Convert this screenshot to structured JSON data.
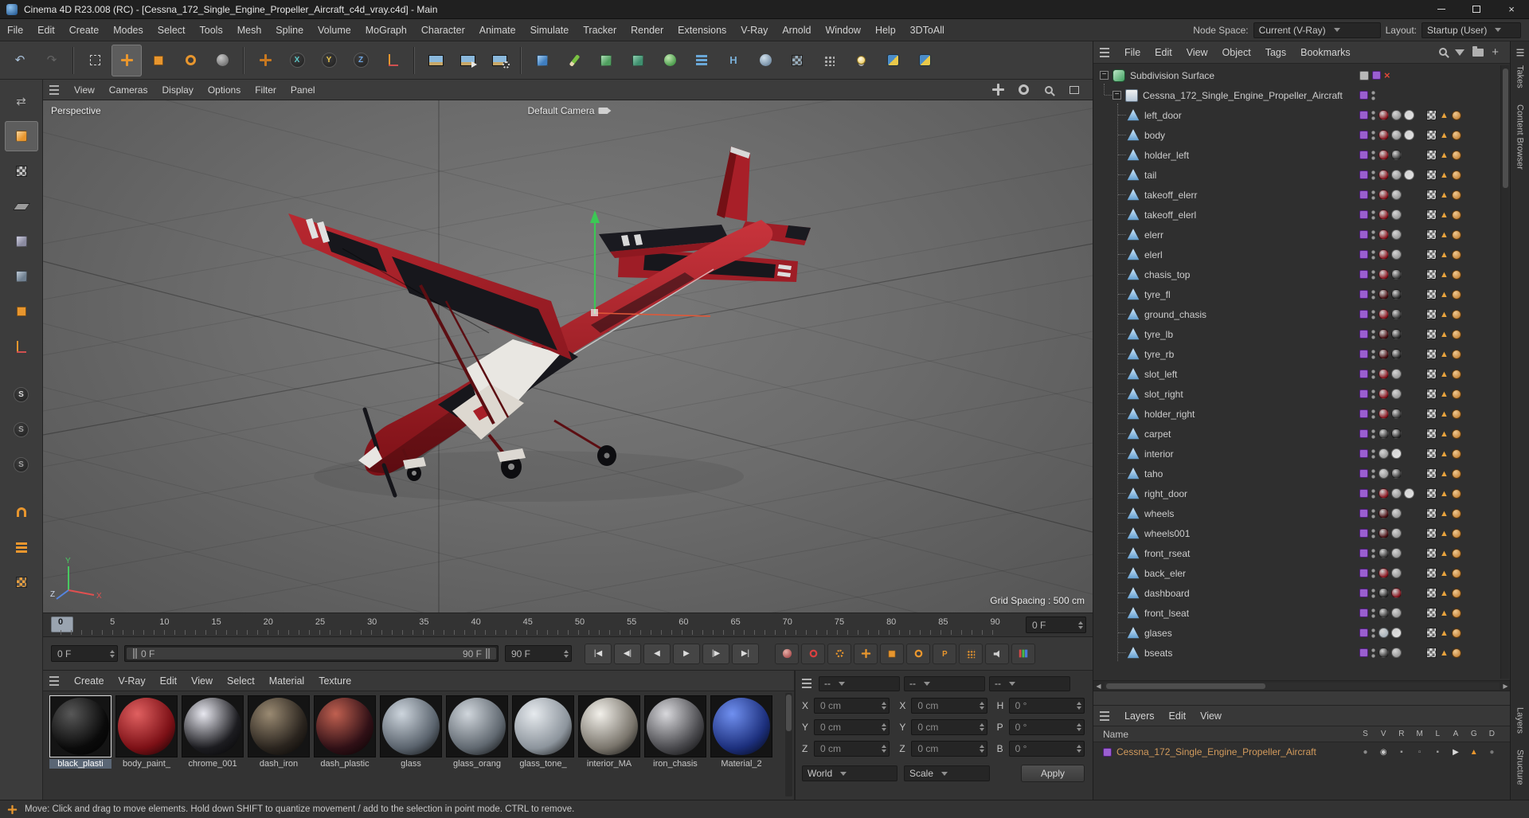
{
  "window": {
    "title": "Cinema 4D R23.008 (RC) - [Cessna_172_Single_Engine_Propeller_Aircraft_c4d_vray.c4d] - Main"
  },
  "menubar": {
    "items": [
      "File",
      "Edit",
      "Create",
      "Modes",
      "Select",
      "Tools",
      "Mesh",
      "Spline",
      "Volume",
      "MoGraph",
      "Character",
      "Animate",
      "Simulate",
      "Tracker",
      "Render",
      "Extensions",
      "V-Ray",
      "Arnold",
      "Window",
      "Help",
      "3DToAll"
    ],
    "node_space_label": "Node Space:",
    "node_space_value": "Current (V-Ray)",
    "layout_label": "Layout:",
    "layout_value": "Startup (User)"
  },
  "toolbar": {
    "buttons": [
      {
        "n": "undo-button",
        "t": "glyph",
        "g": "↶",
        "c": "#a8c0d8"
      },
      {
        "n": "redo-button",
        "t": "glyph",
        "g": "↷",
        "c": "#646464"
      },
      {
        "sep": true
      },
      {
        "n": "live-selection-tool",
        "t": "dashed"
      },
      {
        "n": "move-tool",
        "t": "cross",
        "c": "#e8962e",
        "active": true
      },
      {
        "n": "scale-tool",
        "t": "box",
        "c": "#e8962e"
      },
      {
        "n": "rotate-tool",
        "t": "ring",
        "c": "#e8962e"
      },
      {
        "n": "last-used-tool",
        "t": "sphere",
        "c": "#7a7a7a",
        "hi": "#c8c8c8"
      },
      {
        "sep": true
      },
      {
        "n": "omni-move-tool",
        "t": "cross",
        "c": "#c87820"
      },
      {
        "n": "lock-x-axis-button",
        "t": "cletter",
        "g": "X",
        "c": "#5cc8c8"
      },
      {
        "n": "lock-y-axis-button",
        "t": "cletter",
        "g": "Y",
        "c": "#e8c44c"
      },
      {
        "n": "lock-z-axis-button",
        "t": "cletter",
        "g": "Z",
        "c": "#6ea8e8"
      },
      {
        "n": "coordinate-system-button",
        "t": "axes",
        "c": "#e8962e"
      },
      {
        "sep": true
      },
      {
        "n": "render-view-button",
        "t": "pic"
      },
      {
        "n": "render-picture-viewer-button",
        "t": "pic",
        "badge": "play"
      },
      {
        "n": "render-settings-button",
        "t": "pic",
        "badge": "gear"
      },
      {
        "sep": true
      },
      {
        "n": "add-cube-button",
        "t": "cube",
        "c": "#3f7ec0",
        "hi": "#a8d0f0"
      },
      {
        "n": "pen-tool-button",
        "t": "pen",
        "c": "#7ac142"
      },
      {
        "n": "subdivision-surface-button",
        "t": "cube",
        "c": "#4f9f5f",
        "hi": "#b0e0b8"
      },
      {
        "n": "generator-button",
        "t": "cube",
        "c": "#3f8f6f",
        "hi": "#90d0b0"
      },
      {
        "n": "array-button",
        "t": "sphere",
        "c": "#4f9f4f",
        "hi": "#c0e8b0"
      },
      {
        "n": "instance-button",
        "t": "stack",
        "c": "#6aa8d8"
      },
      {
        "n": "connect-button",
        "t": "letter",
        "g": "H",
        "c": "#7ab0d8"
      },
      {
        "n": "volume-builder-button",
        "t": "sphere",
        "c": "#7a92a8",
        "hi": "#d0e0ec"
      },
      {
        "n": "field-button",
        "t": "checker",
        "c": "#9ab0c0"
      },
      {
        "n": "simulate-button",
        "t": "dots",
        "c": "#b0b0b0"
      },
      {
        "n": "light-button",
        "t": "bulb"
      },
      {
        "n": "python-button",
        "t": "py"
      },
      {
        "n": "xpresso-button",
        "t": "py"
      }
    ]
  },
  "left_toolbar": {
    "buttons": [
      {
        "n": "convert-selection-tool",
        "t": "glyph",
        "g": "⇄",
        "c": "#b0b0b0"
      },
      {
        "n": "model-mode-button",
        "t": "cube",
        "c": "#e8962e",
        "hi": "#f8d8a0",
        "active": true
      },
      {
        "n": "texture-mode-button",
        "t": "checker",
        "c": "#c8c8c8"
      },
      {
        "n": "workplane-mode-button",
        "t": "plane",
        "c": "#9a9a9a"
      },
      {
        "n": "points-mode-button",
        "t": "cube",
        "c": "#8a8aa0",
        "hi": "#d0d0e0"
      },
      {
        "n": "edges-mode-button",
        "t": "cube",
        "c": "#708090",
        "hi": "#c0ccd8"
      },
      {
        "n": "polygons-mode-button",
        "t": "box",
        "c": "#e8962e"
      },
      {
        "n": "axis-mode-button",
        "t": "axes",
        "c": "#e8962e"
      },
      {
        "gap": true
      },
      {
        "n": "enable-snap-button",
        "t": "cletter",
        "g": "S",
        "c": "#d8d8d8"
      },
      {
        "n": "snap-setting-1-button",
        "t": "cletter",
        "g": "S",
        "c": "#a0a0a0"
      },
      {
        "n": "snap-setting-2-button",
        "t": "cletter",
        "g": "S",
        "c": "#a0a0a0"
      },
      {
        "gap": true
      },
      {
        "n": "magnet-snap-button",
        "t": "magnet",
        "c": "#e8962e"
      },
      {
        "n": "quantize-button",
        "t": "stack",
        "c": "#e8962e"
      },
      {
        "n": "workplane-snap-button",
        "t": "checker",
        "c": "#e8a040"
      }
    ]
  },
  "viewport": {
    "menu": [
      "View",
      "Cameras",
      "Display",
      "Options",
      "Filter",
      "Panel"
    ],
    "view_icons": [
      {
        "n": "pan-view-button",
        "t": "cross",
        "c": "#c0c0c0"
      },
      {
        "n": "orbit-view-button",
        "t": "ring",
        "c": "#c0c0c0"
      },
      {
        "n": "zoom-view-button",
        "t": "search"
      },
      {
        "n": "maximize-view-button",
        "t": "frame"
      }
    ],
    "label": "Perspective",
    "camera_label": "Default Camera",
    "grid_spacing": "Grid Spacing : 500 cm",
    "axis_x": "X",
    "axis_y": "Y",
    "axis_z": "Z"
  },
  "timeline": {
    "ticks": [
      "0",
      "5",
      "10",
      "15",
      "20",
      "25",
      "30",
      "35",
      "40",
      "45",
      "50",
      "55",
      "60",
      "65",
      "70",
      "75",
      "80",
      "85",
      "90"
    ],
    "frame_field": "0 F",
    "start_field": "0 F",
    "end_field": "90 F",
    "range_start": "0 F",
    "range_end": "90 F",
    "transport": [
      {
        "name": "jump-start-button",
        "glyph": "|◀"
      },
      {
        "name": "previous-frame-button",
        "glyph": "◀|"
      },
      {
        "name": "previous-key-button",
        "glyph": "◀"
      },
      {
        "name": "play-button",
        "glyph": "▶"
      },
      {
        "name": "next-frame-button",
        "glyph": "|▶"
      },
      {
        "name": "jump-end-button",
        "glyph": "▶|"
      }
    ],
    "record": [
      {
        "n": "record-scrub-button",
        "t": "sphere",
        "c": "#b05858",
        "hi": "#e8b0a8"
      },
      {
        "n": "keyframe-record-button",
        "t": "ring",
        "c": "#d84040"
      },
      {
        "n": "autokey-button",
        "t": "gear",
        "c": "#e8962e"
      },
      {
        "n": "record-position-toggle",
        "t": "cross",
        "c": "#e8962e"
      },
      {
        "n": "record-scale-toggle",
        "t": "box",
        "c": "#e8962e"
      },
      {
        "n": "record-rotation-toggle",
        "t": "ring",
        "c": "#e8962e"
      },
      {
        "n": "record-parameter-toggle",
        "t": "letter",
        "g": "P",
        "c": "#e8962e"
      },
      {
        "n": "record-pla-toggle",
        "t": "dots",
        "c": "#e8962e"
      },
      {
        "n": "sound-toggle",
        "t": "speaker"
      },
      {
        "n": "timeline-chart-button",
        "t": "bars"
      }
    ]
  },
  "materials": {
    "menu": [
      "Create",
      "V-Ray",
      "Edit",
      "View",
      "Select",
      "Material",
      "Texture"
    ],
    "items": [
      {
        "name": "black_plasti",
        "base": "#0a0a0a",
        "highlight": "#585858",
        "selected": true
      },
      {
        "name": "body_paint_",
        "base": "#7c1016",
        "highlight": "#e06060"
      },
      {
        "name": "chrome_001",
        "base": "#1c1c20",
        "highlight": "#e8e8f0"
      },
      {
        "name": "dash_iron",
        "base": "#2a241e",
        "highlight": "#9a8a72"
      },
      {
        "name": "dash_plastic",
        "base": "#301016",
        "highlight": "#c06050"
      },
      {
        "name": "glass",
        "base": "#5a636d",
        "highlight": "#cdd5dd"
      },
      {
        "name": "glass_orang",
        "base": "#606870",
        "highlight": "#d0d6dc"
      },
      {
        "name": "glass_tone_",
        "base": "#8c949c",
        "highlight": "#e6eaee"
      },
      {
        "name": "interior_MA",
        "base": "#7a756c",
        "highlight": "#f2f0ea"
      },
      {
        "name": "iron_chasis",
        "base": "#4a4a4e",
        "highlight": "#d8d8dc"
      },
      {
        "name": "Material_2",
        "base": "#1c2f7c",
        "highlight": "#7090f0"
      }
    ]
  },
  "coordinates": {
    "filters": [
      "--",
      "--",
      "--"
    ],
    "rows": [
      {
        "a": "X",
        "av": "0 cm",
        "b": "X",
        "bv": "0 cm",
        "c": "H",
        "cv": "0 °"
      },
      {
        "a": "Y",
        "av": "0 cm",
        "b": "Y",
        "bv": "0 cm",
        "c": "P",
        "cv": "0 °"
      },
      {
        "a": "Z",
        "av": "0 cm",
        "b": "Z",
        "bv": "0 cm",
        "c": "B",
        "cv": "0 °"
      }
    ],
    "world": "World",
    "scale": "Scale",
    "apply": "Apply"
  },
  "object_manager": {
    "menu": [
      "File",
      "Edit",
      "View",
      "Object",
      "Tags",
      "Bookmarks"
    ],
    "root": "Subdivision Surface",
    "parent": "Cessna_172_Single_Engine_Propeller_Aircraft",
    "objects": [
      {
        "name": "left_door",
        "mats": [
          "#8a1620",
          "#9a9a9a",
          "#e0e0e0"
        ]
      },
      {
        "name": "body",
        "mats": [
          "#8a1620",
          "#9a9a9a",
          "#e0e0e0"
        ]
      },
      {
        "name": "holder_left",
        "mats": [
          "#8a1620",
          "#3a3a3a"
        ]
      },
      {
        "name": "tail",
        "mats": [
          "#8a1620",
          "#9a9a9a",
          "#e0e0e0"
        ]
      },
      {
        "name": "takeoff_elerr",
        "mats": [
          "#8a1620",
          "#9a9a9a"
        ]
      },
      {
        "name": "takeoff_elerl",
        "mats": [
          "#8a1620",
          "#9a9a9a"
        ]
      },
      {
        "name": "elerr",
        "mats": [
          "#8a1620",
          "#9a9a9a"
        ]
      },
      {
        "name": "elerl",
        "mats": [
          "#8a1620",
          "#9a9a9a"
        ]
      },
      {
        "name": "chasis_top",
        "mats": [
          "#8a1620",
          "#3a3a3a"
        ]
      },
      {
        "name": "tyre_fl",
        "mats": [
          "#4a1014",
          "#2a2a2a"
        ]
      },
      {
        "name": "ground_chasis",
        "mats": [
          "#8a1620",
          "#3a3a3a"
        ]
      },
      {
        "name": "tyre_lb",
        "mats": [
          "#4a1014",
          "#2a2a2a"
        ]
      },
      {
        "name": "tyre_rb",
        "mats": [
          "#4a1014",
          "#2a2a2a"
        ]
      },
      {
        "name": "slot_left",
        "mats": [
          "#8a1620",
          "#9a9a9a"
        ]
      },
      {
        "name": "slot_right",
        "mats": [
          "#8a1620",
          "#9a9a9a"
        ]
      },
      {
        "name": "holder_right",
        "mats": [
          "#8a1620",
          "#3a3a3a"
        ]
      },
      {
        "name": "carpet",
        "mats": [
          "#3a3a3a",
          "#2a2a2a"
        ]
      },
      {
        "name": "interior",
        "mats": [
          "#9a9a9a",
          "#e0e0e0"
        ]
      },
      {
        "name": "taho",
        "mats": [
          "#9a9a9a",
          "#3a3a3a"
        ]
      },
      {
        "name": "right_door",
        "mats": [
          "#8a1620",
          "#9a9a9a",
          "#e0e0e0"
        ]
      },
      {
        "name": "wheels",
        "mats": [
          "#4a1014",
          "#9a9a9a"
        ]
      },
      {
        "name": "wheels001",
        "mats": [
          "#4a1014",
          "#9a9a9a"
        ]
      },
      {
        "name": "front_rseat",
        "mats": [
          "#3a3a3a",
          "#9a9a9a"
        ]
      },
      {
        "name": "back_eler",
        "mats": [
          "#8a1620",
          "#9a9a9a"
        ]
      },
      {
        "name": "dashboard",
        "mats": [
          "#2a2a2a",
          "#8a1620"
        ]
      },
      {
        "name": "front_lseat",
        "mats": [
          "#3a3a3a",
          "#9a9a9a"
        ]
      },
      {
        "name": "glases",
        "mats": [
          "#aab4bc",
          "#e0e0e0"
        ]
      },
      {
        "name": "bseats",
        "mats": [
          "#3a3a3a",
          "#9a9a9a"
        ]
      }
    ]
  },
  "layers": {
    "menu": [
      "Layers",
      "Edit",
      "View"
    ],
    "name_header": "Name",
    "columns": [
      "S",
      "V",
      "R",
      "M",
      "L",
      "A",
      "G",
      "D"
    ],
    "rows": [
      {
        "name": "Cessna_172_Single_Engine_Propeller_Aircraft",
        "color": "#9a5fd0"
      }
    ],
    "row_icons": [
      {
        "name": "solo-icon",
        "glyph": "●",
        "color": "#8a8a8a"
      },
      {
        "name": "visibility-icon",
        "glyph": "◉",
        "color": "#c8c8c8"
      },
      {
        "name": "render-icon",
        "glyph": "▪",
        "color": "#9a9a9a"
      },
      {
        "name": "manager-icon",
        "glyph": "▫",
        "color": "#9a9a9a"
      },
      {
        "name": "lock-icon",
        "glyph": "▪",
        "color": "#9a9a9a"
      },
      {
        "name": "animation-icon",
        "glyph": "▶",
        "color": "#d8d8d8"
      },
      {
        "name": "generators-icon",
        "glyph": "▲",
        "color": "#e8962e"
      },
      {
        "name": "deformers-icon",
        "glyph": "●",
        "color": "#777777"
      }
    ]
  },
  "side_tabs": {
    "top": [
      "Takes",
      "Content Browser"
    ],
    "bottom": [
      "Layers",
      "Structure"
    ]
  },
  "statusbar": {
    "text": "Move: Click and drag to move elements. Hold down SHIFT to quantize movement / add to the selection in point mode. CTRL to remove."
  },
  "colors": {
    "accent": "#e8962e",
    "selection": "#5a6675",
    "layer_purple": "#9a5fd0",
    "plane_red": "#b3242c"
  }
}
